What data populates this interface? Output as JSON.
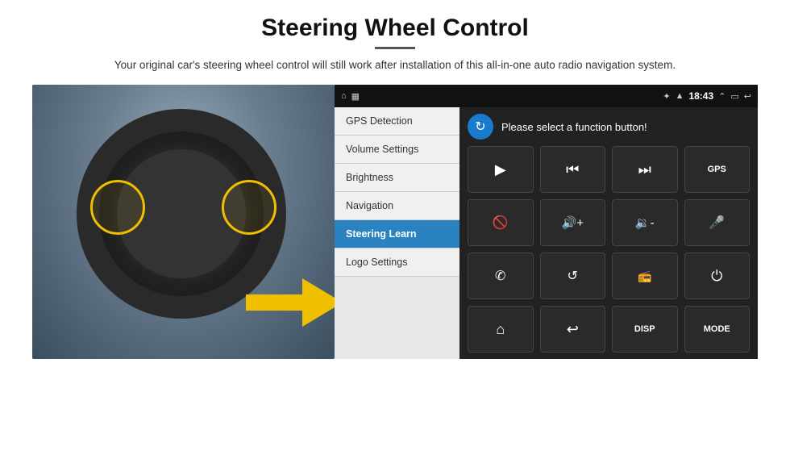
{
  "header": {
    "title": "Steering Wheel Control",
    "divider": true,
    "subtitle": "Your original car's steering wheel control will still work after installation of this all-in-one auto radio navigation system."
  },
  "statusBar": {
    "time": "18:43",
    "icons_left": [
      "home-icon",
      "screenshot-icon"
    ],
    "icons_right": [
      "bluetooth-icon",
      "wifi-icon",
      "signal-icon",
      "expand-icon",
      "minimize-icon",
      "back-icon"
    ]
  },
  "menu": {
    "items": [
      {
        "id": "gps-detection",
        "label": "GPS Detection",
        "active": false
      },
      {
        "id": "volume-settings",
        "label": "Volume Settings",
        "active": false
      },
      {
        "id": "brightness",
        "label": "Brightness",
        "active": false
      },
      {
        "id": "navigation",
        "label": "Navigation",
        "active": false
      },
      {
        "id": "steering-learn",
        "label": "Steering Learn",
        "active": true
      },
      {
        "id": "logo-settings",
        "label": "Logo Settings",
        "active": false
      }
    ]
  },
  "controlPanel": {
    "prompt": "Please select a function button!",
    "refreshBtn": "↻",
    "buttons": [
      {
        "id": "play",
        "icon": "play-icon",
        "symbol": "▶",
        "label": "Play"
      },
      {
        "id": "prev",
        "icon": "prev-icon",
        "symbol": "⏮",
        "label": "Previous"
      },
      {
        "id": "next",
        "icon": "next-icon",
        "symbol": "⏭",
        "label": "Next"
      },
      {
        "id": "gps",
        "icon": "gps-icon",
        "symbol": "GPS",
        "label": "GPS",
        "isText": true
      },
      {
        "id": "mute",
        "icon": "mute-icon",
        "symbol": "⊘",
        "label": "Mute"
      },
      {
        "id": "vol-up",
        "icon": "vol-up-icon",
        "symbol": "◄+",
        "label": "Volume Up"
      },
      {
        "id": "vol-down",
        "icon": "vol-down-icon",
        "symbol": "◄-",
        "label": "Volume Down"
      },
      {
        "id": "mic",
        "icon": "mic-icon",
        "symbol": "🎙",
        "label": "Microphone"
      },
      {
        "id": "phone",
        "icon": "phone-icon",
        "symbol": "✆",
        "label": "Phone"
      },
      {
        "id": "rotate",
        "icon": "rotate-icon",
        "symbol": "↺",
        "label": "Rotate"
      },
      {
        "id": "radio",
        "icon": "radio-icon",
        "symbol": "⊛",
        "label": "Radio"
      },
      {
        "id": "power",
        "icon": "power-icon",
        "symbol": "⏻",
        "label": "Power"
      },
      {
        "id": "home",
        "icon": "home-icon",
        "symbol": "⌂",
        "label": "Home"
      },
      {
        "id": "back",
        "icon": "back-icon",
        "symbol": "↩",
        "label": "Back"
      },
      {
        "id": "disp",
        "icon": "disp-icon",
        "symbol": "DISP",
        "label": "Display",
        "isText": true
      },
      {
        "id": "mode",
        "icon": "mode-icon",
        "symbol": "MODE",
        "label": "Mode",
        "isText": true
      }
    ]
  }
}
